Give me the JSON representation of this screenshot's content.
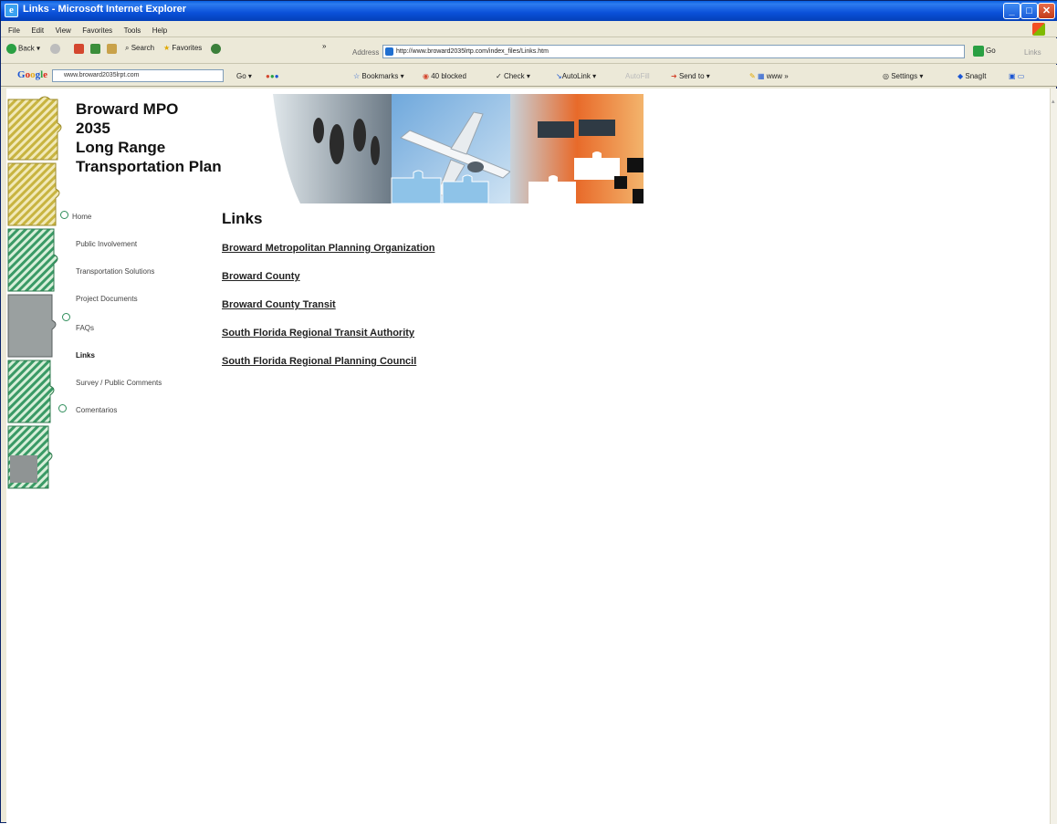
{
  "window": {
    "title": "Links - Microsoft Internet Explorer",
    "app_icon": "ie-icon"
  },
  "menu": [
    "File",
    "Edit",
    "View",
    "Favorites",
    "Tools",
    "Help"
  ],
  "toolbar": {
    "back": "Back",
    "search": "Search",
    "favorites": "Favorites",
    "address_label": "Address",
    "address_value": "http://www.broward2035lrtp.com/index_files/Links.htm",
    "go": "Go",
    "links": "Links"
  },
  "google_toolbar": {
    "search_value": "www.broward2035lrpt.com",
    "go": "Go",
    "bookmarks": "Bookmarks",
    "blocked": "40 blocked",
    "check": "Check",
    "autolink": "AutoLink",
    "autofill": "AutoFill",
    "send_to": "Send to",
    "www": "www",
    "settings": "Settings",
    "snagit": "SnagIt"
  },
  "site": {
    "title_lines": [
      "Broward MPO",
      "2035",
      "Long Range",
      "Transportation Plan"
    ]
  },
  "nav": {
    "items": [
      {
        "label": "Home"
      },
      {
        "label": "Public Involvement"
      },
      {
        "label": "Transportation Solutions"
      },
      {
        "label": "Project Documents"
      },
      {
        "label": "FAQs"
      },
      {
        "label": "Links"
      },
      {
        "label": "Survey / Public Comments"
      },
      {
        "label": "Comentarios"
      }
    ]
  },
  "content": {
    "heading": "Links",
    "links": [
      "Broward Metropolitan Planning Organization",
      "Broward County",
      "Broward County Transit",
      "South Florida Regional Transit Authority",
      "South Florida Regional Planning Council"
    ]
  },
  "colors": {
    "titlebar": "#0a50d8",
    "chrome": "#ece9d8",
    "puzzle_green": "#2e8d5a",
    "puzzle_yellow": "#c8b440"
  }
}
